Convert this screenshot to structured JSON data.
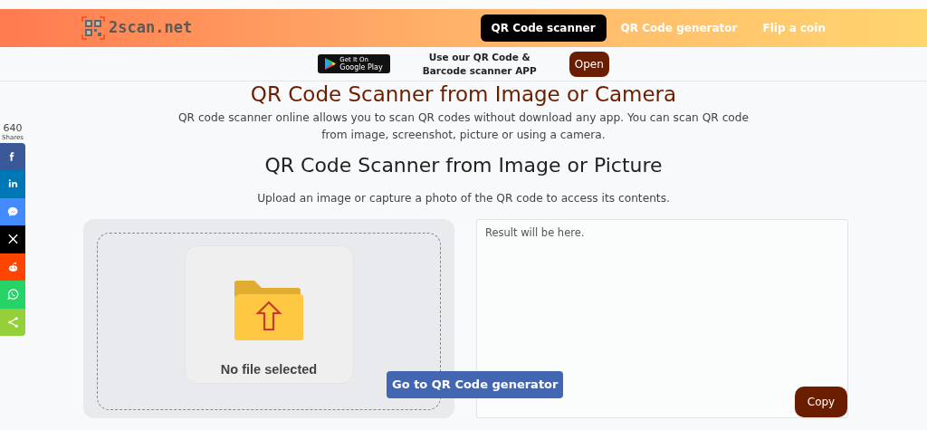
{
  "header": {
    "logo": "2scan.net",
    "nav": [
      {
        "label": "QR Code scanner",
        "selected": true
      },
      {
        "label": "QR Code generator",
        "selected": false
      },
      {
        "label": "Flip a coin",
        "selected": false
      }
    ]
  },
  "app_banner": {
    "badge_line1": "Get It On",
    "badge_line2": "Google Play",
    "text": "Use our QR Code & Barcode scanner APP",
    "button": "Open"
  },
  "share": {
    "count": "640",
    "label": "Shares",
    "buttons": [
      {
        "kind": "facebook",
        "color": "#3b5998"
      },
      {
        "kind": "linkedin",
        "color": "#0077b5"
      },
      {
        "kind": "messenger",
        "color": "#448aff"
      },
      {
        "kind": "x",
        "color": "#000000"
      },
      {
        "kind": "reddit",
        "color": "#ff4500"
      },
      {
        "kind": "whatsapp",
        "color": "#25d366"
      },
      {
        "kind": "share",
        "color": "#95d03a"
      }
    ]
  },
  "title": "QR Code Scanner from Image or Camera",
  "intro": "QR code scanner online allows you to scan QR codes without download any app. You can scan QR code from image, screenshot, picture or using a camera.",
  "subtitle": "QR Code Scanner from Image or Picture",
  "instructions": "Upload an image or capture a photo of the QR code to access its contents.",
  "upload": {
    "status": "No file selected"
  },
  "generator_button": "Go to QR Code generator",
  "result": {
    "placeholder": "Result will be here.",
    "copy_button": "Copy"
  }
}
